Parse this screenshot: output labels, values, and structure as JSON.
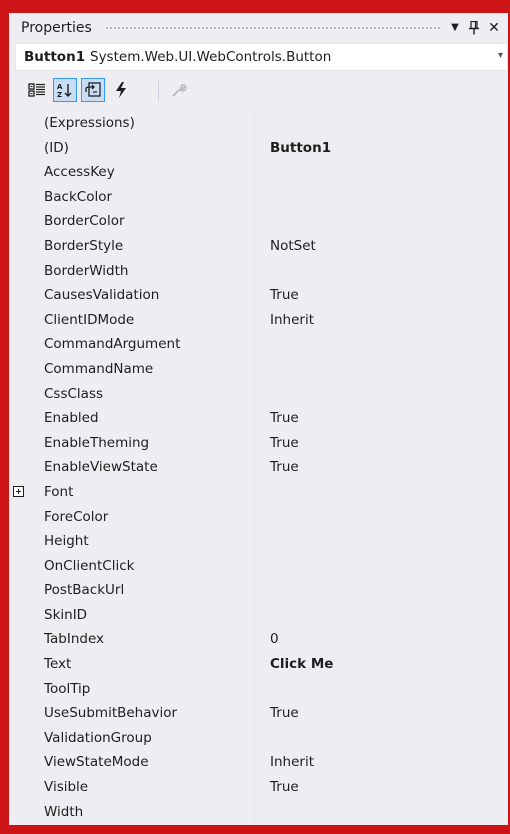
{
  "window": {
    "title": "Properties",
    "dropdown_icon": "▼",
    "pin_icon": "ᛘ",
    "close_icon": "✕"
  },
  "object": {
    "name": "Button1",
    "type": "System.Web.UI.WebControls.Button"
  },
  "toolbar": {
    "buttons": [
      {
        "name": "categorized-icon",
        "active": false
      },
      {
        "name": "alphabetical-icon",
        "active": true
      },
      {
        "name": "properties-icon",
        "active": true
      },
      {
        "name": "events-icon",
        "active": false
      },
      {
        "name": "property-pages-icon",
        "active": false
      }
    ]
  },
  "properties": [
    {
      "name": "(Expressions)",
      "value": "",
      "bold": false
    },
    {
      "name": "(ID)",
      "value": "Button1",
      "bold": true
    },
    {
      "name": "AccessKey",
      "value": "",
      "bold": false
    },
    {
      "name": "BackColor",
      "value": "",
      "bold": false
    },
    {
      "name": "BorderColor",
      "value": "",
      "bold": false
    },
    {
      "name": "BorderStyle",
      "value": "NotSet",
      "bold": false
    },
    {
      "name": "BorderWidth",
      "value": "",
      "bold": false
    },
    {
      "name": "CausesValidation",
      "value": "True",
      "bold": false
    },
    {
      "name": "ClientIDMode",
      "value": "Inherit",
      "bold": false
    },
    {
      "name": "CommandArgument",
      "value": "",
      "bold": false
    },
    {
      "name": "CommandName",
      "value": "",
      "bold": false
    },
    {
      "name": "CssClass",
      "value": "",
      "bold": false
    },
    {
      "name": "Enabled",
      "value": "True",
      "bold": false
    },
    {
      "name": "EnableTheming",
      "value": "True",
      "bold": false
    },
    {
      "name": "EnableViewState",
      "value": "True",
      "bold": false
    },
    {
      "name": "Font",
      "value": "",
      "bold": false,
      "expandable": true
    },
    {
      "name": "ForeColor",
      "value": "",
      "bold": false
    },
    {
      "name": "Height",
      "value": "",
      "bold": false
    },
    {
      "name": "OnClientClick",
      "value": "",
      "bold": false
    },
    {
      "name": "PostBackUrl",
      "value": "",
      "bold": false
    },
    {
      "name": "SkinID",
      "value": "",
      "bold": false
    },
    {
      "name": "TabIndex",
      "value": "0",
      "bold": false
    },
    {
      "name": "Text",
      "value": "Click Me",
      "bold": true
    },
    {
      "name": "ToolTip",
      "value": "",
      "bold": false
    },
    {
      "name": "UseSubmitBehavior",
      "value": "True",
      "bold": false
    },
    {
      "name": "ValidationGroup",
      "value": "",
      "bold": false
    },
    {
      "name": "ViewStateMode",
      "value": "Inherit",
      "bold": false
    },
    {
      "name": "Visible",
      "value": "True",
      "bold": false
    },
    {
      "name": "Width",
      "value": "",
      "bold": false
    }
  ],
  "colors": {
    "frame": "#cc1417",
    "panel": "#eeeef2",
    "active_button": "#c9def5",
    "active_border": "#3399ff"
  }
}
